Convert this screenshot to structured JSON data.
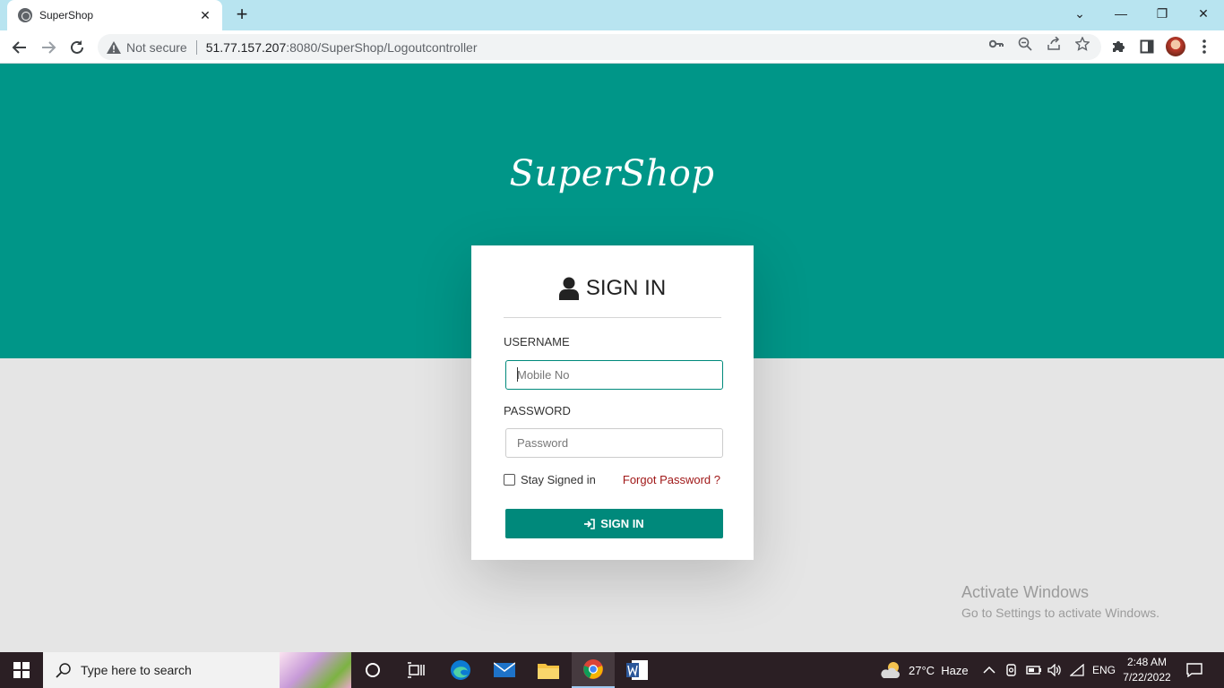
{
  "browser": {
    "tab_title": "SuperShop",
    "close_glyph": "✕",
    "new_tab_glyph": "+",
    "security_label": "Not secure",
    "url_host": "51.77.157.207",
    "url_path": ":8080/SuperShop/Logoutcontroller",
    "window_controls": [
      "⌄",
      "—",
      "❐",
      "✕"
    ]
  },
  "page": {
    "brand": "SuperShop",
    "card_title": "SIGN IN",
    "username_label": "USERNAME",
    "username_placeholder": "Mobile No",
    "username_value": "",
    "password_label": "PASSWORD",
    "password_placeholder": "Password",
    "password_value": "",
    "stay_signed_in_label": "Stay Signed in",
    "stay_signed_in_checked": false,
    "forgot_password": "Forgot Password ?",
    "signin_button": "SIGN IN",
    "accent_color": "#009688"
  },
  "watermark": {
    "line1": "Activate Windows",
    "line2": "Go to Settings to activate Windows."
  },
  "taskbar": {
    "search_placeholder": "Type here to search",
    "weather": "27°C  Haze",
    "language": "ENG",
    "time": "2:48 AM",
    "date": "7/22/2022"
  }
}
